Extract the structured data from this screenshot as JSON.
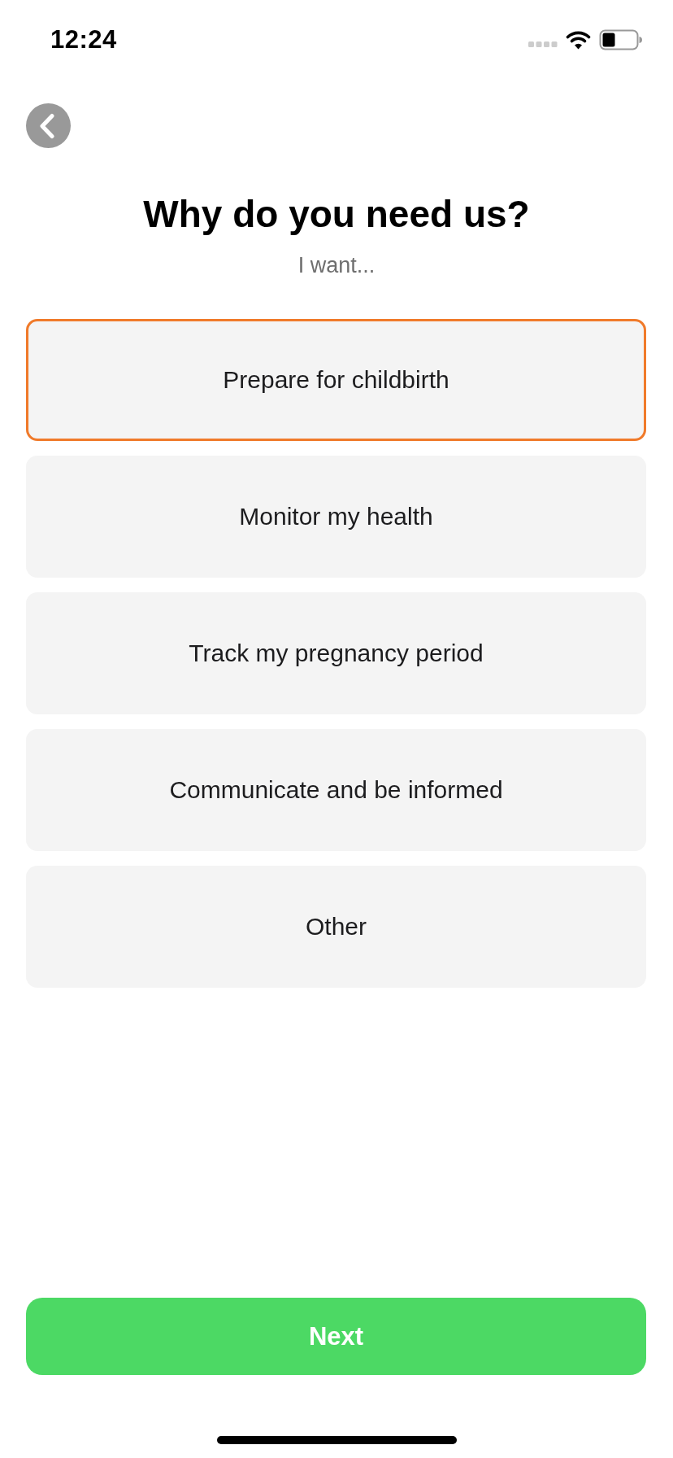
{
  "status_bar": {
    "time": "12:24"
  },
  "header": {
    "title": "Why do you need us?",
    "subtitle": "I want..."
  },
  "options": [
    {
      "label": "Prepare for childbirth",
      "selected": true
    },
    {
      "label": "Monitor my health",
      "selected": false
    },
    {
      "label": "Track my pregnancy period",
      "selected": false
    },
    {
      "label": "Communicate and be informed",
      "selected": false
    },
    {
      "label": "Other",
      "selected": false
    }
  ],
  "next_button": {
    "label": "Next"
  }
}
